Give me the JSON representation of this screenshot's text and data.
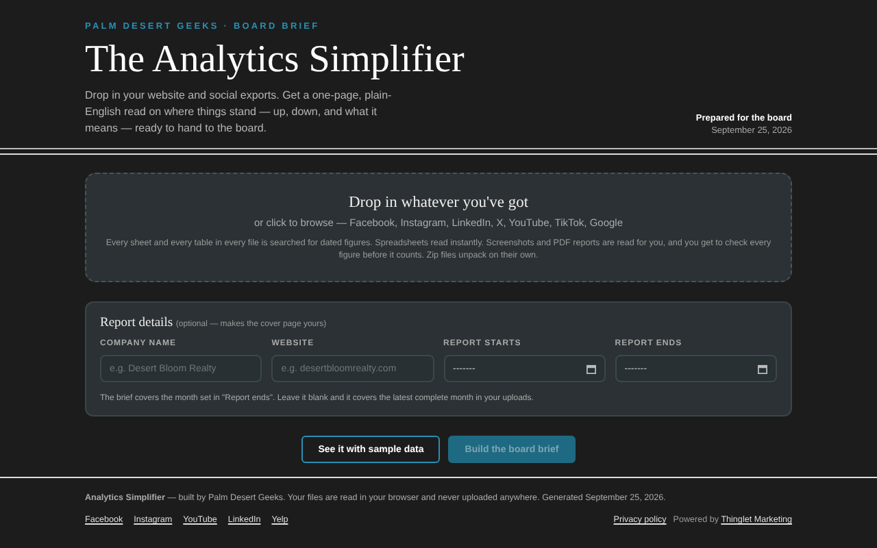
{
  "header": {
    "kicker": "PALM DESERT GEEKS · BOARD BRIEF",
    "title": "The Analytics Simplifier",
    "description": "Drop in your website and social exports. Get a one-page, plain-English read on where things stand — up, down, and what it means — ready to hand to the board.",
    "prepared_label": "Prepared for the board",
    "prepared_date": "September 25, 2026"
  },
  "dropzone": {
    "title": "Drop in whatever you've got",
    "subtitle": "or click to browse — Facebook, Instagram, LinkedIn, X, YouTube, TikTok, Google",
    "note": "Every sheet and every table in every file is searched for dated figures. Spreadsheets read instantly. Screenshots and PDF reports are read for you, and you get to check every figure before it counts. Zip files unpack on their own."
  },
  "details": {
    "title": "Report details",
    "hint": "(optional — makes the cover page yours)",
    "fields": [
      {
        "kind": "text",
        "label": "COMPANY NAME",
        "placeholder": "e.g. Desert Bloom Realty"
      },
      {
        "kind": "text",
        "label": "WEBSITE",
        "placeholder": "e.g. desertbloomrealty.com"
      },
      {
        "kind": "date",
        "label": "REPORT STARTS",
        "value": "-------"
      },
      {
        "kind": "date",
        "label": "REPORT ENDS",
        "value": "-------"
      }
    ],
    "note": "The brief covers the month set in \"Report ends\". Leave it blank and it covers the latest complete month in your uploads."
  },
  "buttons": [
    {
      "label": "See it with sample data",
      "kind": "outline",
      "disabled": false
    },
    {
      "label": "Build the board brief",
      "kind": "primary",
      "disabled": true
    }
  ],
  "footer": {
    "brand": "Analytics Simplifier",
    "text": "— built by Palm Desert Geeks. Your files are read in your browser and never uploaded anywhere. Generated September 25, 2026.",
    "links": [
      "Facebook",
      "Instagram",
      "YouTube",
      "LinkedIn",
      "Yelp"
    ],
    "privacy": "Privacy policy",
    "powered_label": "Powered by",
    "powered_link": "Thinglet Marketing"
  }
}
